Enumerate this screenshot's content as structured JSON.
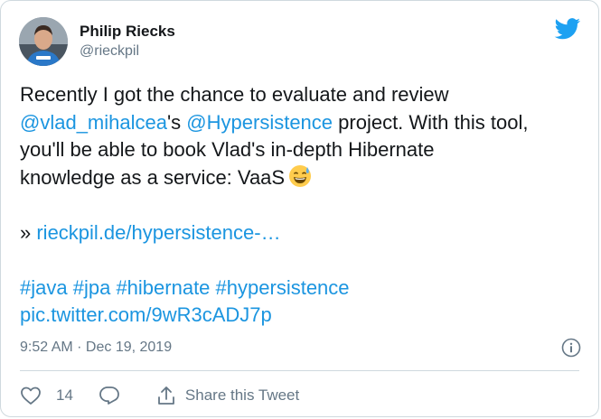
{
  "author": {
    "name": "Philip Riecks",
    "handle": "@rieckpil"
  },
  "tweet": {
    "line1": "Recently I got the chance to evaluate and review",
    "mention1": "@vlad_mihalcea",
    "mention1_suffix": "'s ",
    "mention2": "@Hypersistence",
    "line2_rest": " project. With this tool,",
    "line3": "you'll be able to book Vlad's in-depth Hibernate",
    "line4": "knowledge as a service: VaaS",
    "emoji": "grinning-face-with-sweat",
    "link_prefix": "» ",
    "link": "rieckpil.de/hypersistence-…",
    "hashtags": [
      "#java",
      "#jpa",
      "#hibernate",
      "#hypersistence"
    ],
    "pic_link": "pic.twitter.com/9wR3cADJ7p"
  },
  "meta": {
    "timestamp": "9:52 AM · Dec 19, 2019"
  },
  "actions": {
    "like_count": "14",
    "share_label": "Share this Tweet"
  },
  "colors": {
    "link": "#1b95e0",
    "brand": "#1da1f2",
    "muted": "#657786",
    "text": "#14171a"
  }
}
